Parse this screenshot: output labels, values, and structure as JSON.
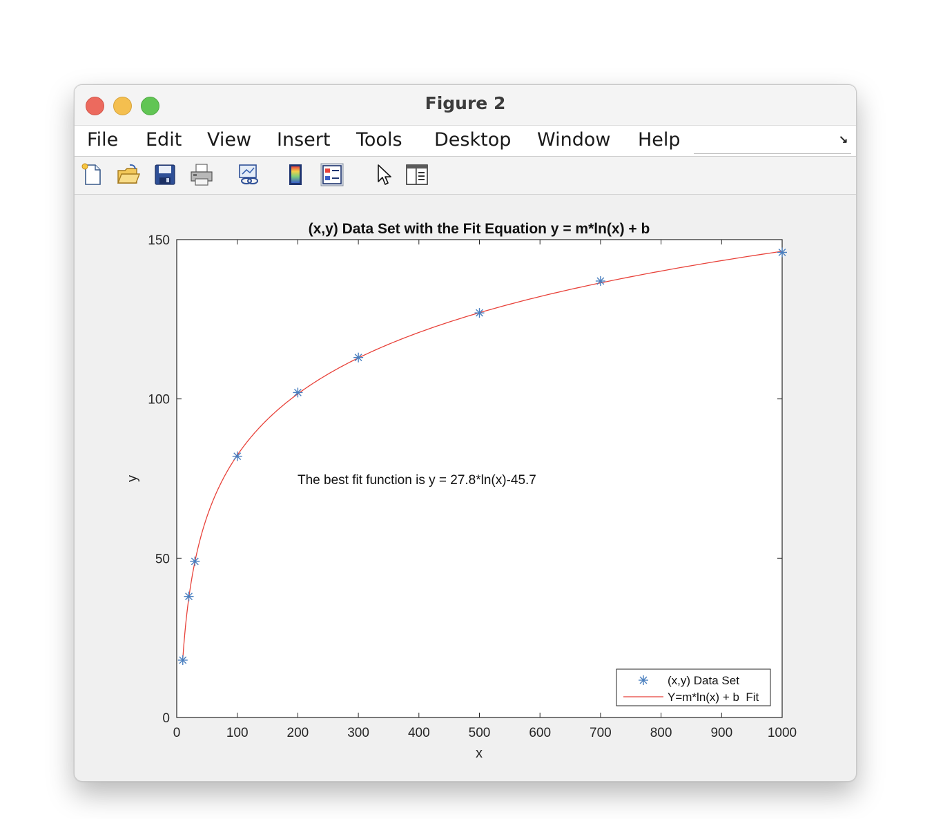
{
  "window": {
    "title": "Figure 2"
  },
  "menu": {
    "items": [
      "File",
      "Edit",
      "View",
      "Insert",
      "Tools",
      "Desktop",
      "Window",
      "Help"
    ]
  },
  "toolbar": {
    "icons": [
      "new-figure-icon",
      "open-file-icon",
      "save-icon",
      "print-icon",
      "link-plot-icon",
      "colorbar-icon",
      "legend-icon",
      "pointer-icon",
      "property-inspector-icon"
    ]
  },
  "chart_data": {
    "type": "scatter",
    "title": "(x,y) Data Set with the Fit Equation y = m*ln(x) + b",
    "xlabel": "x",
    "ylabel": "y",
    "xlim": [
      0,
      1000
    ],
    "ylim": [
      0,
      150
    ],
    "xticks": [
      0,
      100,
      200,
      300,
      400,
      500,
      600,
      700,
      800,
      900,
      1000
    ],
    "yticks": [
      0,
      50,
      100,
      150
    ],
    "grid": false,
    "legend_position": "bottom-right",
    "annotation": "The best fit function is y = 27.8*ln(x)-45.7",
    "series": [
      {
        "name": "(x,y) Data Set",
        "kind": "markers",
        "marker": "asterisk",
        "color": "#4a7fbf",
        "x": [
          10,
          20,
          30,
          100,
          200,
          300,
          500,
          700,
          1000
        ],
        "y": [
          18,
          38,
          49,
          82,
          102,
          113,
          127,
          137,
          146
        ]
      },
      {
        "name": "Y=m*ln(x) + b  Fit",
        "kind": "line",
        "color": "#e8423a",
        "fit": {
          "m": 27.8,
          "b": -45.7,
          "x_start": 10,
          "x_end": 1000
        }
      }
    ]
  }
}
